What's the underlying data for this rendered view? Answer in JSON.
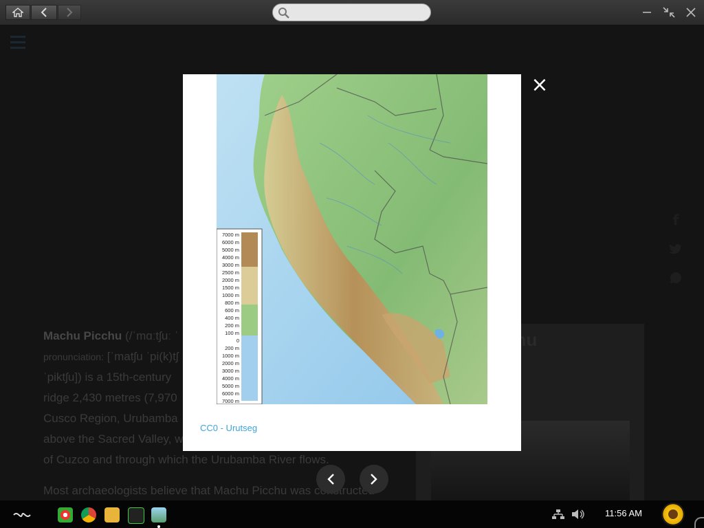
{
  "browser": {
    "search": {
      "placeholder": ""
    }
  },
  "article": {
    "title_term": "Machu Picchu",
    "ipa_partial": "(/ˈmɑːtʃuː ˈ",
    "pronunciation_label": "pronunciation:",
    "pronunciation_value": "[ˈmatʃu ˈpi(k)tʃ",
    "line3": "ˈpiktʃu]) is a 15th-century",
    "line4": "ridge 2,430 metres (7,970",
    "line5": "Cusco Region, Urubamba",
    "line6": "above the Sacred Valley, w",
    "line7": "of Cuzco and through which the Urubamba River flows.",
    "para2": "Most archaeologists believe that Machu Picchu was constructed"
  },
  "infobox": {
    "title_partial": "chu"
  },
  "lightbox": {
    "caption": "CC0 - Urutseg",
    "close_glyph": "×",
    "legend": [
      "7000 m",
      "6000 m",
      "5000 m",
      "4000 m",
      "3000 m",
      "2500 m",
      "2000 m",
      "1500 m",
      "1000 m",
      "800 m",
      "600 m",
      "400 m",
      "200 m",
      "100 m",
      "0",
      "200 m",
      "1000 m",
      "2000 m",
      "3000 m",
      "4000 m",
      "5000 m",
      "6000 m",
      "7000 m"
    ]
  },
  "taskbar": {
    "clock": "11:56 AM"
  },
  "colors": {
    "accent_link": "#3ca5da",
    "sea": "#a7d4ef",
    "land_low": "#8fc07f",
    "land_high": "#b48b50"
  }
}
